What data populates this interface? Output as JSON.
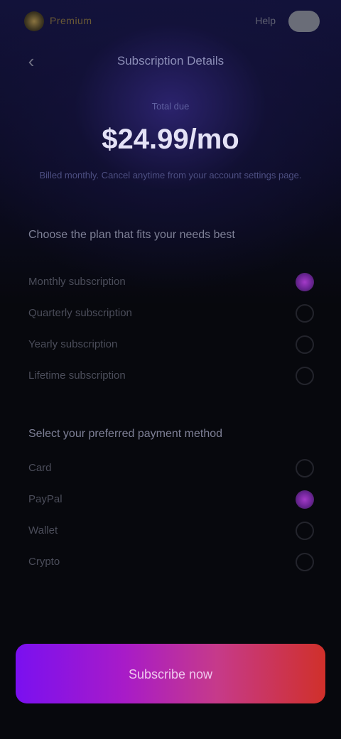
{
  "topbar": {
    "brand": "Premium",
    "link": "Help",
    "back_icon": "chevron-left-icon"
  },
  "header": {
    "title": "Subscription Details"
  },
  "hero": {
    "eyebrow": "Total due",
    "price": "$24.99/mo",
    "subtitle": "Billed monthly. Cancel anytime from your account settings page."
  },
  "sections": [
    {
      "title": "Choose the plan that fits your needs best",
      "selected_index": 0,
      "options": [
        {
          "label": "Monthly subscription"
        },
        {
          "label": "Quarterly subscription"
        },
        {
          "label": "Yearly subscription"
        },
        {
          "label": "Lifetime subscription"
        }
      ]
    },
    {
      "title": "Select your preferred payment method",
      "selected_index": 1,
      "options": [
        {
          "label": "Card"
        },
        {
          "label": "PayPal"
        },
        {
          "label": "Wallet"
        },
        {
          "label": "Crypto"
        }
      ]
    }
  ],
  "cta": {
    "label": "Subscribe now"
  },
  "colors": {
    "accent_start": "#7a10f0",
    "accent_end": "#d0302a",
    "selected_radio": "#a43ac8"
  }
}
